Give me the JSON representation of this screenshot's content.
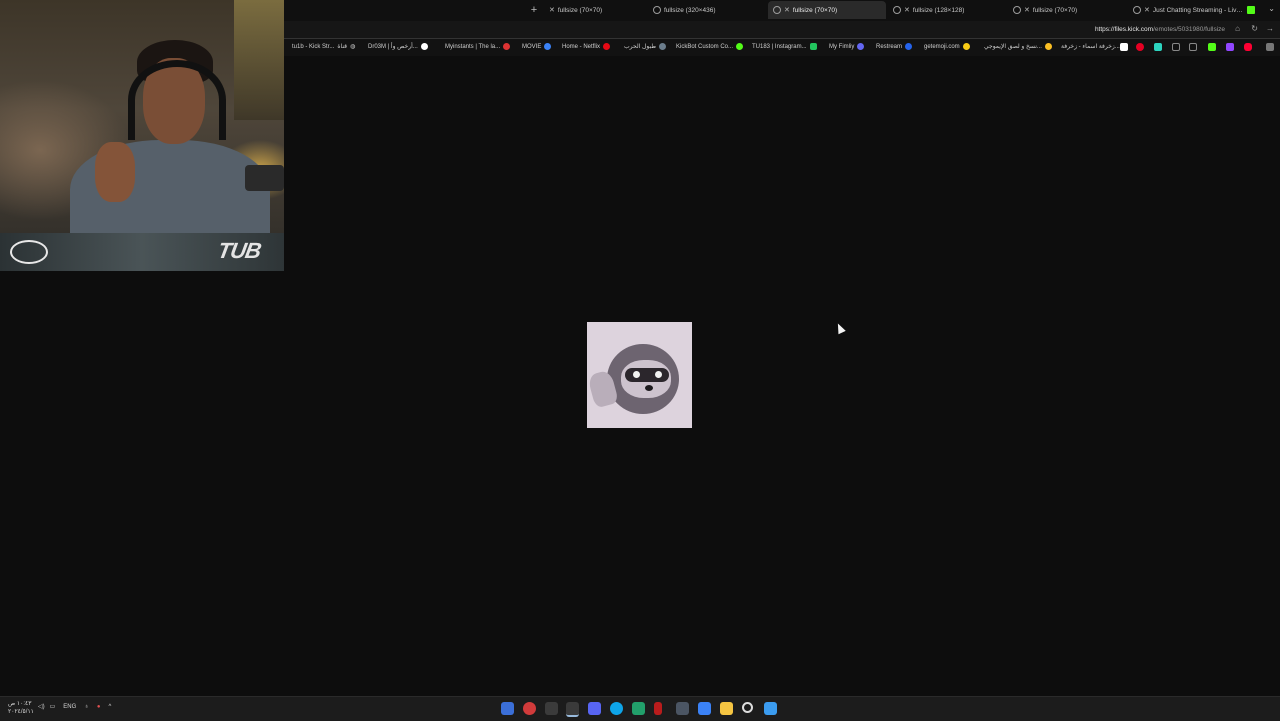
{
  "browser": {
    "tabs": [
      {
        "title": "fullsize (70×70)",
        "active": false
      },
      {
        "title": "fullsize (320×436)",
        "active": false
      },
      {
        "title": "fullsize (70×70)",
        "active": true
      },
      {
        "title": "fullsize (128×128)",
        "active": false
      },
      {
        "title": "fullsize (70×70)",
        "active": false
      },
      {
        "title": "Just Chatting Streaming - Live Stre",
        "active": false
      }
    ],
    "url_host": "https://files.kick.com",
    "url_path": "/emotes/5031980/fullsize"
  },
  "bookmarks": [
    "tu1b - Kick Str...",
    "قناة",
    "Dr03M | أرخص وأ...",
    "Myinstants | The la...",
    "MOVIE",
    "Home - Netflix",
    "طبول الحرب",
    "KickBot Custom Co...",
    "TU183 | Instagram...",
    "My Fimliy",
    "Restream",
    "getemoji.com",
    "نسخ و لصق الإيموجي...",
    "زخرفة اسماء - زخرفة..."
  ],
  "webcam": {
    "brand": "TUB"
  },
  "content": {
    "emote_alt": "raccoon emote"
  },
  "taskbar": {
    "time": "١٠:٤٣ ص",
    "date": "٢٠٢٤/٥/١١",
    "language": "ENG"
  },
  "colors": {
    "page_bg": "#0d0d0d",
    "kick_green": "#53fc18",
    "active_tab": "#2a2a2a"
  }
}
